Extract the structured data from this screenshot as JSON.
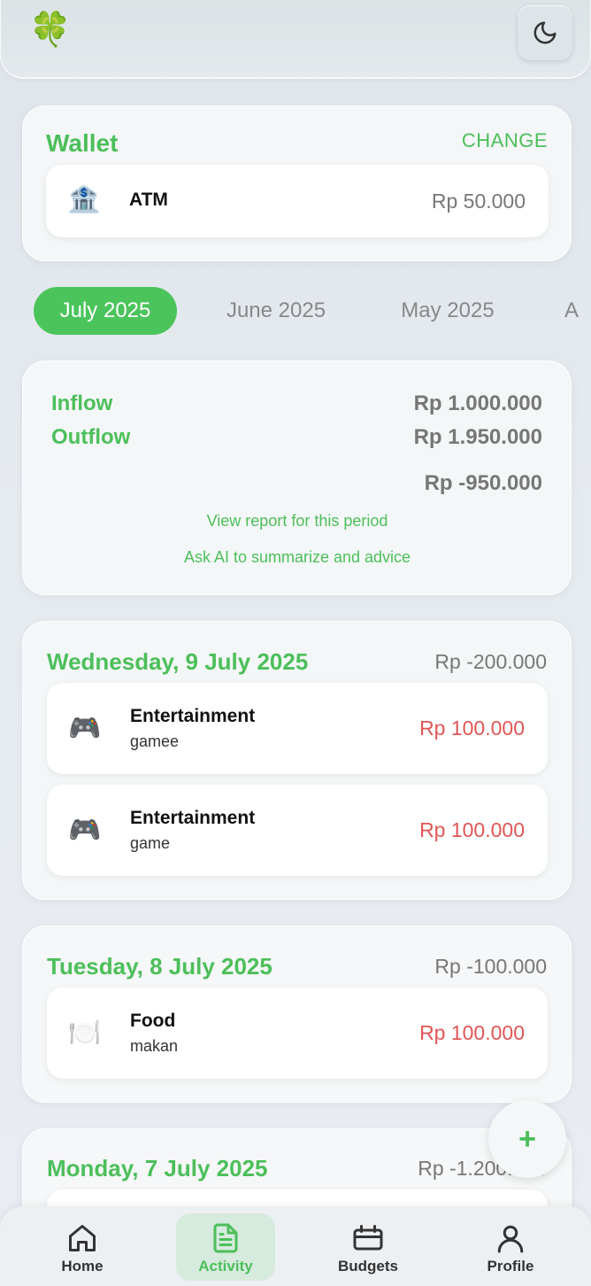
{
  "header": {
    "logo_icon": "four-leaf-clover-icon",
    "logo_glyph": "🍀",
    "theme_icon": "moon-icon"
  },
  "wallet": {
    "title": "Wallet",
    "change_label": "CHANGE",
    "item": {
      "icon": "bank-icon",
      "glyph": "🏦",
      "name": "ATM",
      "amount": "Rp 50.000"
    }
  },
  "periods": [
    "July 2025",
    "June 2025",
    "May 2025",
    "A"
  ],
  "active_period": "July 2025",
  "summary": {
    "inflow_label": "Inflow",
    "inflow_value": "Rp 1.000.000",
    "outflow_label": "Outflow",
    "outflow_value": "Rp 1.950.000",
    "net_value": "Rp -950.000",
    "report_link": "View report for this period",
    "ai_link": "Ask AI to summarize and advice"
  },
  "days": [
    {
      "title": "Wednesday, 9 July 2025",
      "total": "Rp -200.000",
      "transactions": [
        {
          "icon": "game-controller-icon",
          "glyph": "🎮",
          "category": "Entertainment",
          "note": "gamee",
          "amount": "Rp 100.000"
        },
        {
          "icon": "game-controller-icon",
          "glyph": "🎮",
          "category": "Entertainment",
          "note": "game",
          "amount": "Rp 100.000"
        }
      ]
    },
    {
      "title": "Tuesday, 8 July 2025",
      "total": "Rp -100.000",
      "transactions": [
        {
          "icon": "plate-cutlery-icon",
          "glyph": "🍽️",
          "category": "Food",
          "note": "makan",
          "amount": "Rp 100.000"
        }
      ]
    },
    {
      "title": "Monday, 7 July 2025",
      "total": "Rp -1.200.000",
      "transactions": []
    }
  ],
  "fab": {
    "icon": "plus-icon",
    "glyph": "+"
  },
  "nav": [
    {
      "label": "Home",
      "icon": "home-icon"
    },
    {
      "label": "Activity",
      "icon": "document-icon"
    },
    {
      "label": "Budgets",
      "icon": "wallet-icon"
    },
    {
      "label": "Profile",
      "icon": "user-icon"
    }
  ],
  "colors": {
    "accent": "#4cbf5a",
    "expense": "#e05656",
    "muted": "#777777"
  }
}
